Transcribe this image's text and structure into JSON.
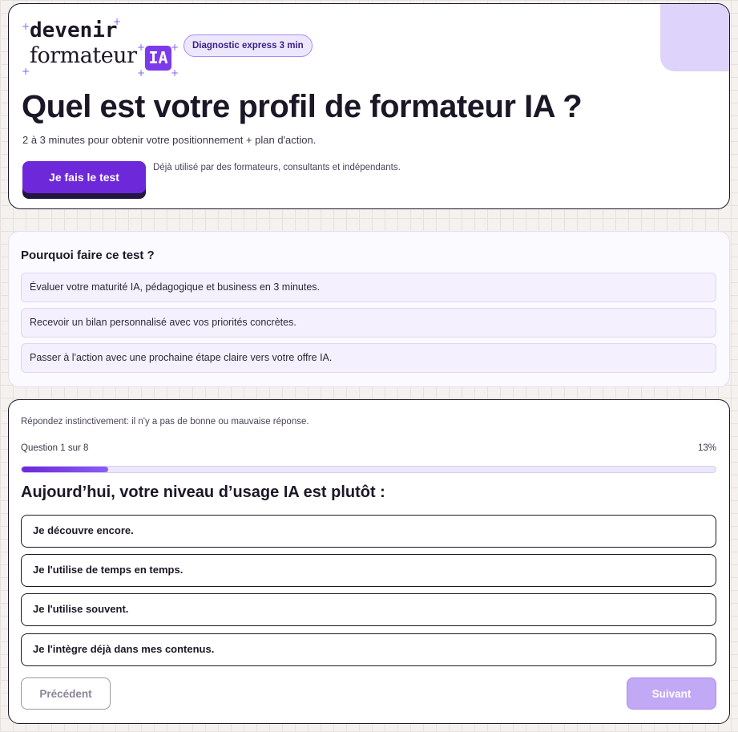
{
  "brand": {
    "logo_line1": "devenir",
    "logo_line2": "formateur",
    "logo_badge": "IA",
    "accent": "#6d28d9"
  },
  "hero": {
    "pill": "Diagnostic express 3 min",
    "title": "Quel est votre profil de formateur IA ?",
    "subtitle": "2 à 3 minutes pour obtenir votre positionnement + plan d'action.",
    "cta_label": "Je fais le test",
    "cta_note": "Déjà utilisé par des formateurs, consultants et indépendants."
  },
  "why": {
    "title": "Pourquoi faire ce test ?",
    "items": [
      "Évaluer votre maturité IA, pédagogique et business en 3 minutes.",
      "Recevoir un bilan personnalisé avec vos priorités concrètes.",
      "Passer à l'action avec une prochaine étape claire vers votre offre IA."
    ]
  },
  "quiz": {
    "intro": "Répondez instinctivement: il n'y a pas de bonne ou mauvaise réponse.",
    "question_count": "Question 1 sur 8",
    "progress_label": "13%",
    "progress_fraction": 0.125,
    "question": "Aujourd’hui, votre niveau d’usage IA est plutôt :",
    "options": [
      "Je découvre encore.",
      "Je l'utilise de temps en temps.",
      "Je l'utilise souvent.",
      "Je l'intègre déjà dans mes contenus."
    ],
    "prev_label": "Précédent",
    "next_label": "Suivant"
  }
}
